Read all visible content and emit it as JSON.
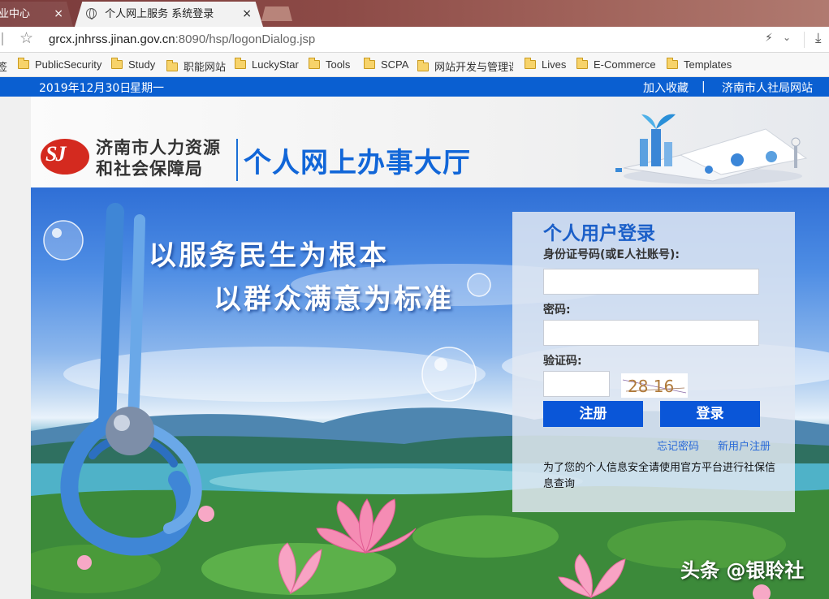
{
  "browser": {
    "tabs": [
      {
        "label": "业中心",
        "active": false
      },
      {
        "label": "个人网上服务  系统登录",
        "active": true
      }
    ],
    "close_glyph": "×",
    "url_host": "grcx.jnhrss.jinan.gov.cn",
    "url_rest": ":8090/hsp/logonDialog.jsp",
    "bookmarks": [
      {
        "label": "签"
      },
      {
        "label": "PublicSecurity"
      },
      {
        "label": "Study"
      },
      {
        "label": "职能网站"
      },
      {
        "label": "LuckyStar"
      },
      {
        "label": "Tools"
      },
      {
        "label": "SCPA"
      },
      {
        "label": "网站开发与管理课"
      },
      {
        "label": "Lives"
      },
      {
        "label": "E-Commerce"
      },
      {
        "label": "Templates"
      }
    ]
  },
  "topbar": {
    "date": "2019年12月30日",
    "weekday": "星期一",
    "favorite": "加入收藏",
    "separator": "|",
    "site_link": "济南市人社局网站"
  },
  "header": {
    "logo_text": "SJ",
    "org_line1": "济南市人力资源",
    "org_line2": "和社会保障局",
    "hall_title": "个人网上办事大厅"
  },
  "hero": {
    "slogan1": "以服务民生为根本",
    "slogan2": "以群众满意为标准"
  },
  "login": {
    "title": "个人用户登录",
    "id_label": "身份证号码(或E人社账号):",
    "password_label": "密码:",
    "captcha_label": "验证码:",
    "captcha_text": "28 16",
    "register_button": "注册",
    "login_button": "登录",
    "forgot_link": "忘记密码",
    "new_user_link": "新用户注册",
    "notice": "为了您的个人信息安全请使用官方平台进行社保信息查询"
  },
  "watermark": "头条 @银聆社",
  "colors": {
    "brand_blue": "#0a56d8",
    "topbar_blue": "#0a5fd1",
    "logo_red": "#d42a1f"
  }
}
